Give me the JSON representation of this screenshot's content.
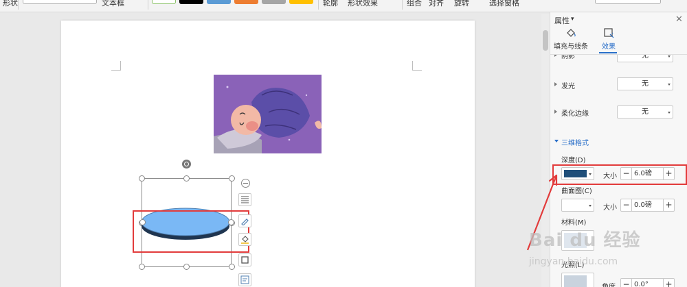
{
  "toolbar": {
    "shape_effects_label": "形状效果",
    "outline_label": "轮廓",
    "text_box_label": "文本框",
    "combine_label": "组合",
    "align_label": "对齐",
    "rotate_label": "旋转",
    "select_pane_label": "选择窗格",
    "shape_fill_label": "形状",
    "swatch_colors": [
      "#ffffff",
      "#000000",
      "#5b9bd5",
      "#ed7d31",
      "#a5a5a5",
      "#ffc000"
    ]
  },
  "panel": {
    "title": "属性",
    "tabs": [
      {
        "label": "填充与线条",
        "icon": "paint-bucket-icon",
        "active": false
      },
      {
        "label": "效果",
        "icon": "effects-icon",
        "active": true
      }
    ],
    "shadow": {
      "label": "阴影",
      "value": "无"
    },
    "glow": {
      "label": "发光",
      "value": "无"
    },
    "soft_edges": {
      "label": "柔化边缘",
      "value": "无"
    },
    "format_3d": {
      "title": "三维格式",
      "depth": {
        "label": "深度(D)",
        "color": "#1f4e79",
        "size_label": "大小",
        "size_value": "6.0磅"
      },
      "contour": {
        "label": "曲面图(C)",
        "color": "#ffffff",
        "size_label": "大小",
        "size_value": "0.0磅"
      },
      "material_label": "材料(M)",
      "lighting_label": "光照(L)",
      "angle_label": "角度",
      "angle_value": "0.0°"
    }
  },
  "shape": {
    "fill_color": "#7ab8f5",
    "depth_color": "#1f3550"
  },
  "highlight_color": "#e23b3b",
  "watermark": {
    "brand": "Bai du 经验",
    "url": "jingyan.baidu.com"
  }
}
